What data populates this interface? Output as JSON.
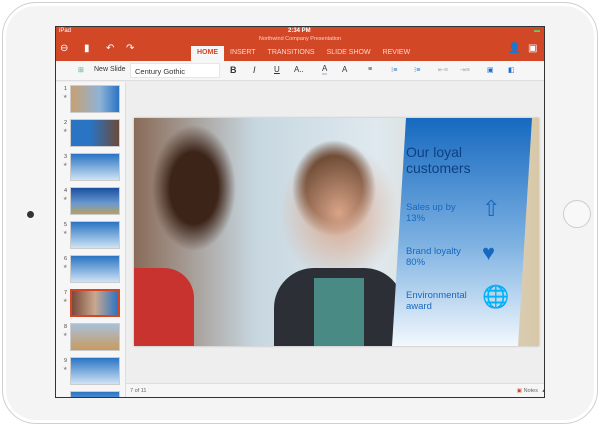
{
  "status": {
    "device": "iPad",
    "time": "2:34 PM"
  },
  "doc_title": "Northwind Company Presentation",
  "tabs": [
    "HOME",
    "INSERT",
    "TRANSITIONS",
    "SLIDE SHOW",
    "REVIEW"
  ],
  "active_tab": "HOME",
  "toolbar": {
    "new_slide": "New Slide",
    "font": "Century Gothic",
    "bold": "B",
    "italic": "I",
    "underline": "U",
    "font_size": "A..",
    "font_color": "A",
    "highlight": "A"
  },
  "slides": {
    "count": 11,
    "selected": 7,
    "numbers": [
      "1",
      "2",
      "3",
      "4",
      "5",
      "6",
      "7",
      "8",
      "9"
    ]
  },
  "slide": {
    "title": "Our loyal customers",
    "items": [
      {
        "text": "Sales up by 13%",
        "icon": "dollar-up-arrow-icon"
      },
      {
        "text": "Brand loyalty 80%",
        "icon": "heart-icon"
      },
      {
        "text": "Environmental award",
        "icon": "globe-award-icon"
      }
    ]
  },
  "footer": {
    "position": "7 of 11",
    "notes": "Notes"
  },
  "colors": {
    "accent": "#d24726",
    "slide_blue": "#1669c0"
  }
}
